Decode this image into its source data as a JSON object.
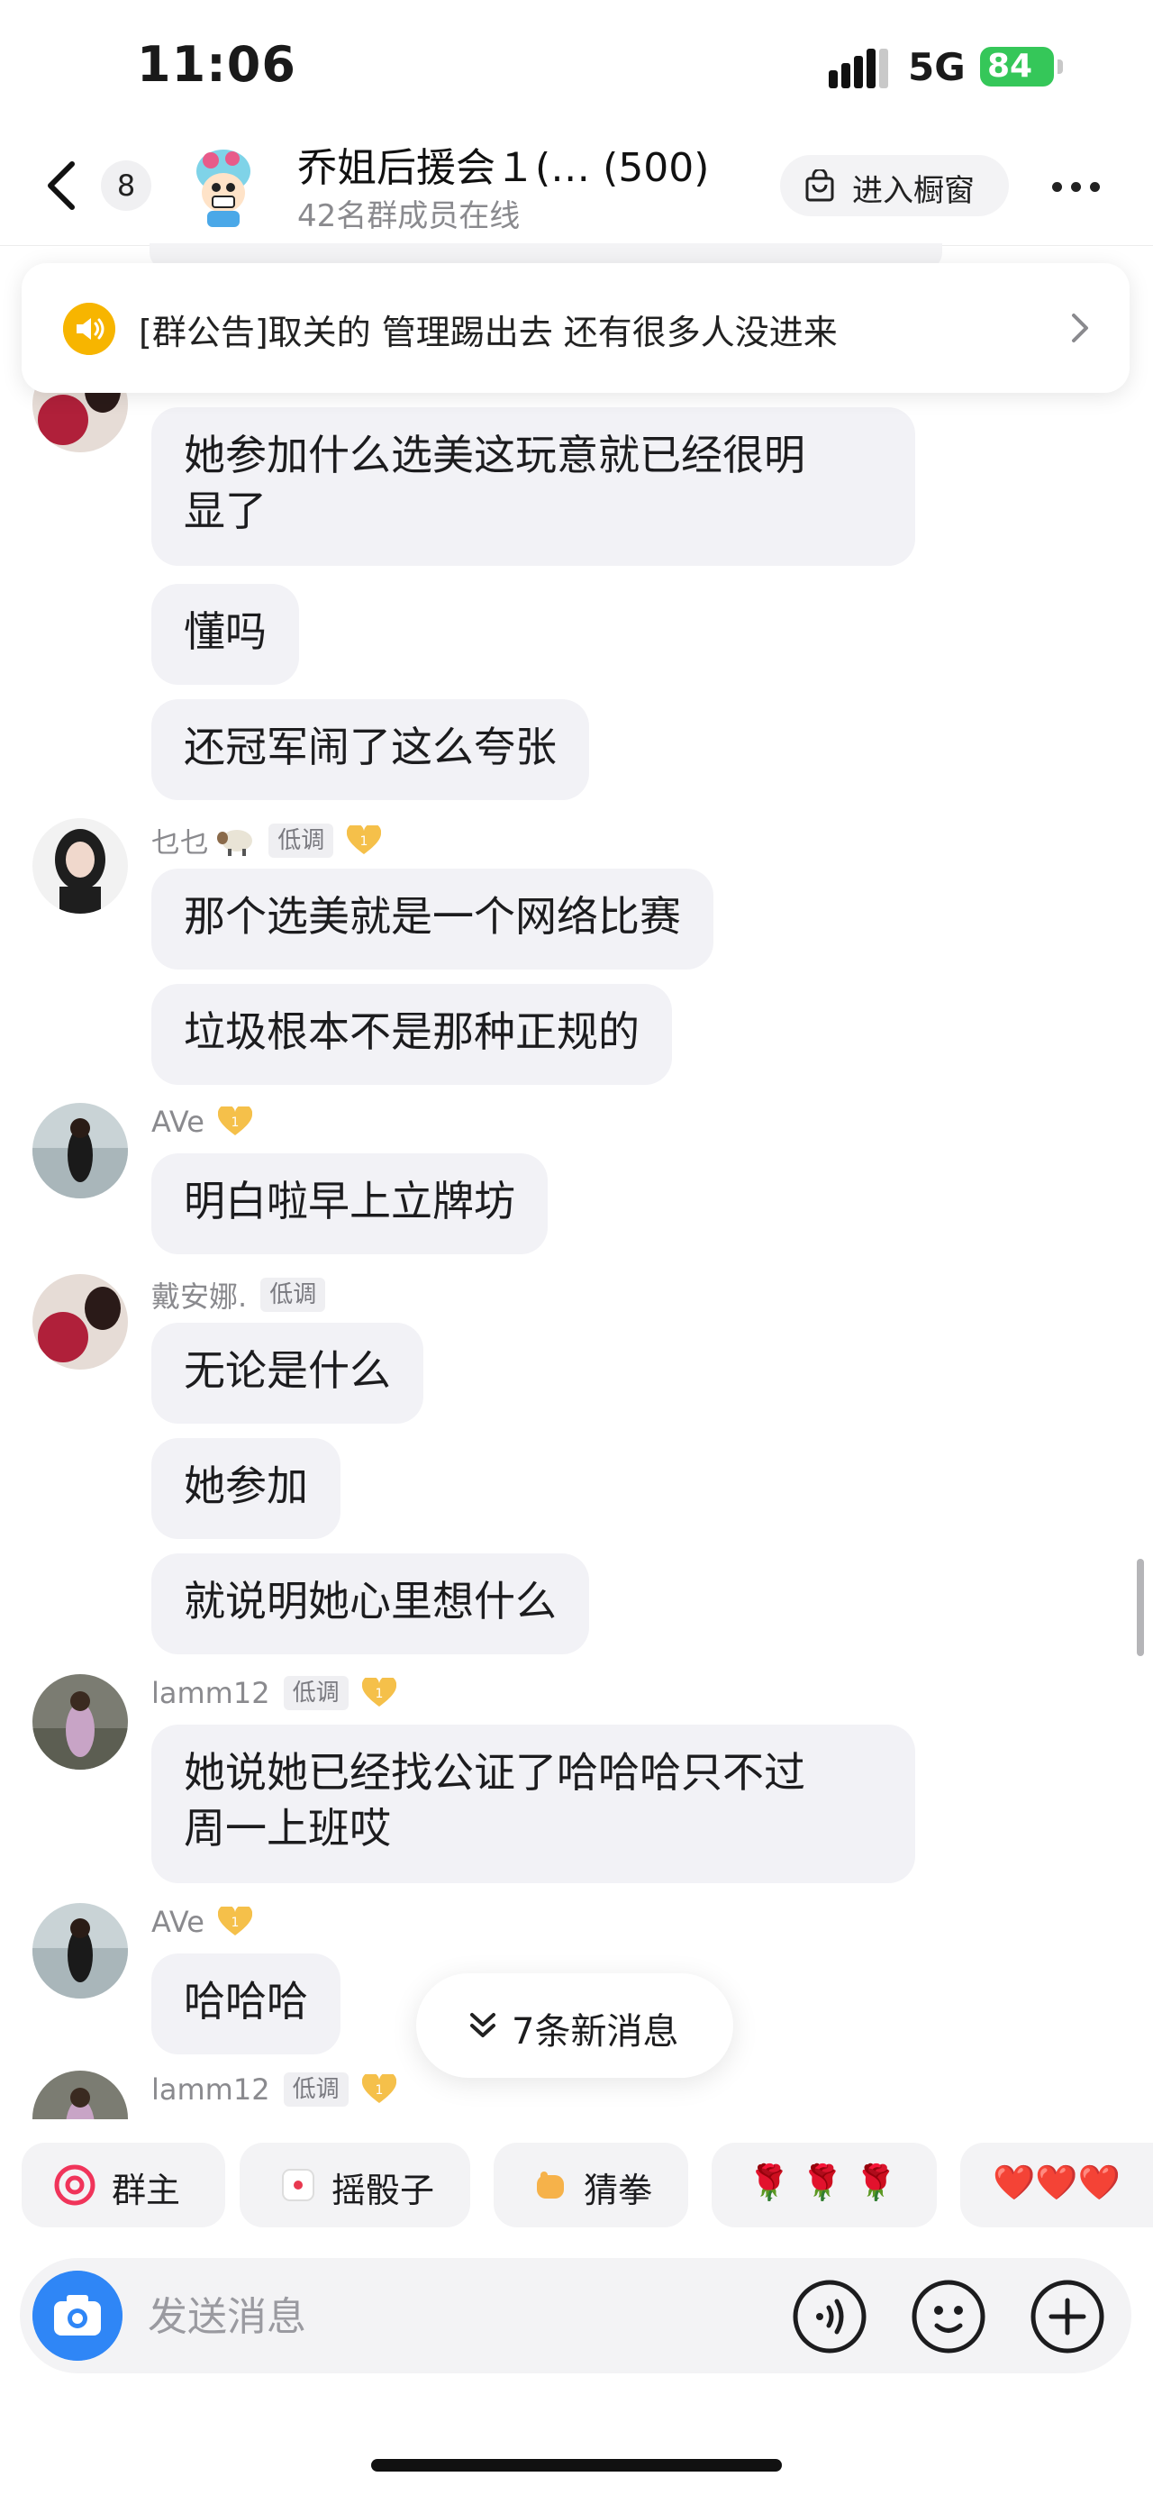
{
  "status_bar": {
    "time": "11:06",
    "network": "5G",
    "battery": "84"
  },
  "header": {
    "back_icon": "chevron-left-icon",
    "unread_count": "8",
    "title": "乔姐后援会１(… (500)",
    "subtitle": "42名群成员在线",
    "shop_label": "进入橱窗",
    "more_icon": "more-dots-icon"
  },
  "announcement": {
    "icon": "speaker-icon",
    "text": "[群公告]取关的 管理踢出去 还有很多人没进来"
  },
  "messages": [
    {
      "bubbles": [
        "她参加什么选美这玩意就已经很明",
        "显了",
        "懂吗",
        "还冠军闹了这么夸张"
      ]
    },
    {
      "sender": "乜乜",
      "tag": "低调",
      "bubbles": [
        "那个选美就是一个网络比赛",
        "垃圾根本不是那种正规的"
      ]
    },
    {
      "sender": "AVe",
      "bubbles": [
        "明白啦早上立牌坊"
      ]
    },
    {
      "sender": "戴安娜.",
      "tag": "低调",
      "bubbles": [
        "无论是什么",
        "她参加",
        "就说明她心里想什么"
      ]
    },
    {
      "sender": "lamm12",
      "tag": "低调",
      "bubbles": [
        "她说她已经找公证了哈哈哈只不过",
        "周一上班哎"
      ]
    },
    {
      "sender": "AVe",
      "bubbles": [
        "哈哈哈"
      ]
    },
    {
      "sender": "lamm12",
      "tag": "低调"
    }
  ],
  "new_messages_label": "7条新消息",
  "quick_actions": [
    {
      "label": "群主",
      "icon": "at-icon"
    },
    {
      "label": "摇骰子",
      "icon": "dice-icon"
    },
    {
      "label": "猜拳",
      "icon": "fist-icon"
    },
    {
      "label": "🌹 🌹 🌹",
      "icon": "rose-icon"
    },
    {
      "label": "❤️❤️❤️",
      "icon": "heart-icon"
    }
  ],
  "input": {
    "placeholder": "发送消息"
  },
  "colors": {
    "accent": "#2f86f6",
    "bubble": "#f2f2f6",
    "battery": "#35c759",
    "announce_icon": "#f7b500"
  }
}
